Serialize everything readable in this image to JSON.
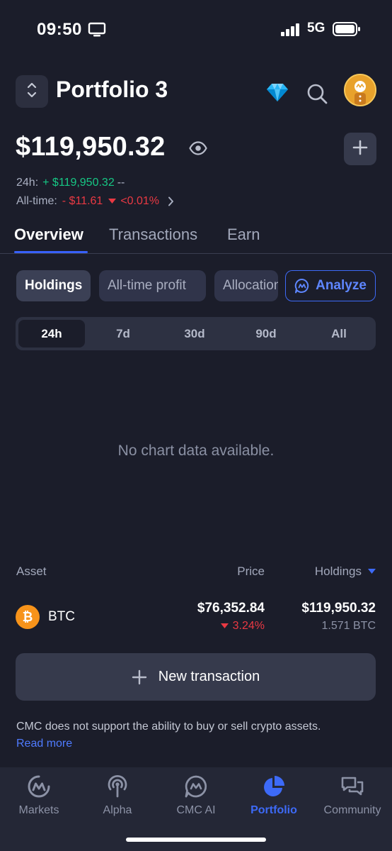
{
  "status_bar": {
    "time": "09:50",
    "network": "5G"
  },
  "header": {
    "title": "Portfolio 3"
  },
  "balance": {
    "total": "$119,950.32",
    "change_24h_label": "24h:",
    "change_24h_value": "+ $119,950.32",
    "change_24h_pct": "--",
    "alltime_label": "All-time:",
    "alltime_value": "- $11.61",
    "alltime_pct": "<0.01%"
  },
  "tabs": [
    {
      "label": "Overview",
      "active": true
    },
    {
      "label": "Transactions",
      "active": false
    },
    {
      "label": "Earn",
      "active": false
    }
  ],
  "chips": [
    {
      "label": "Holdings",
      "active": true
    },
    {
      "label": "All-time profit",
      "active": false
    },
    {
      "label": "Allocation",
      "active": false
    }
  ],
  "analyze_label": "Analyze",
  "ranges": [
    {
      "label": "24h",
      "active": true
    },
    {
      "label": "7d",
      "active": false
    },
    {
      "label": "30d",
      "active": false
    },
    {
      "label": "90d",
      "active": false
    },
    {
      "label": "All",
      "active": false
    }
  ],
  "chart_placeholder": "No chart data available.",
  "table": {
    "col_asset": "Asset",
    "col_price": "Price",
    "col_holdings": "Holdings",
    "rows": [
      {
        "symbol": "BTC",
        "price": "$76,352.84",
        "change": "3.24%",
        "holdings_value": "$119,950.32",
        "holdings_amount": "1.571 BTC"
      }
    ]
  },
  "new_transaction_label": "New transaction",
  "disclaimer": "CMC does not support the ability to buy or sell crypto assets.",
  "read_more": "Read more",
  "bottom_nav": [
    {
      "label": "Markets",
      "icon": "cmc-logo-icon",
      "active": false
    },
    {
      "label": "Alpha",
      "icon": "broadcast-icon",
      "active": false
    },
    {
      "label": "CMC AI",
      "icon": "cmc-ai-icon",
      "active": false
    },
    {
      "label": "Portfolio",
      "icon": "pie-chart-icon",
      "active": true
    },
    {
      "label": "Community",
      "icon": "chat-icon",
      "active": false
    }
  ],
  "colors": {
    "background": "#1b1d2a",
    "accent": "#3861fb",
    "positive": "#16c784",
    "negative": "#ea3943",
    "btc": "#f7931a"
  }
}
